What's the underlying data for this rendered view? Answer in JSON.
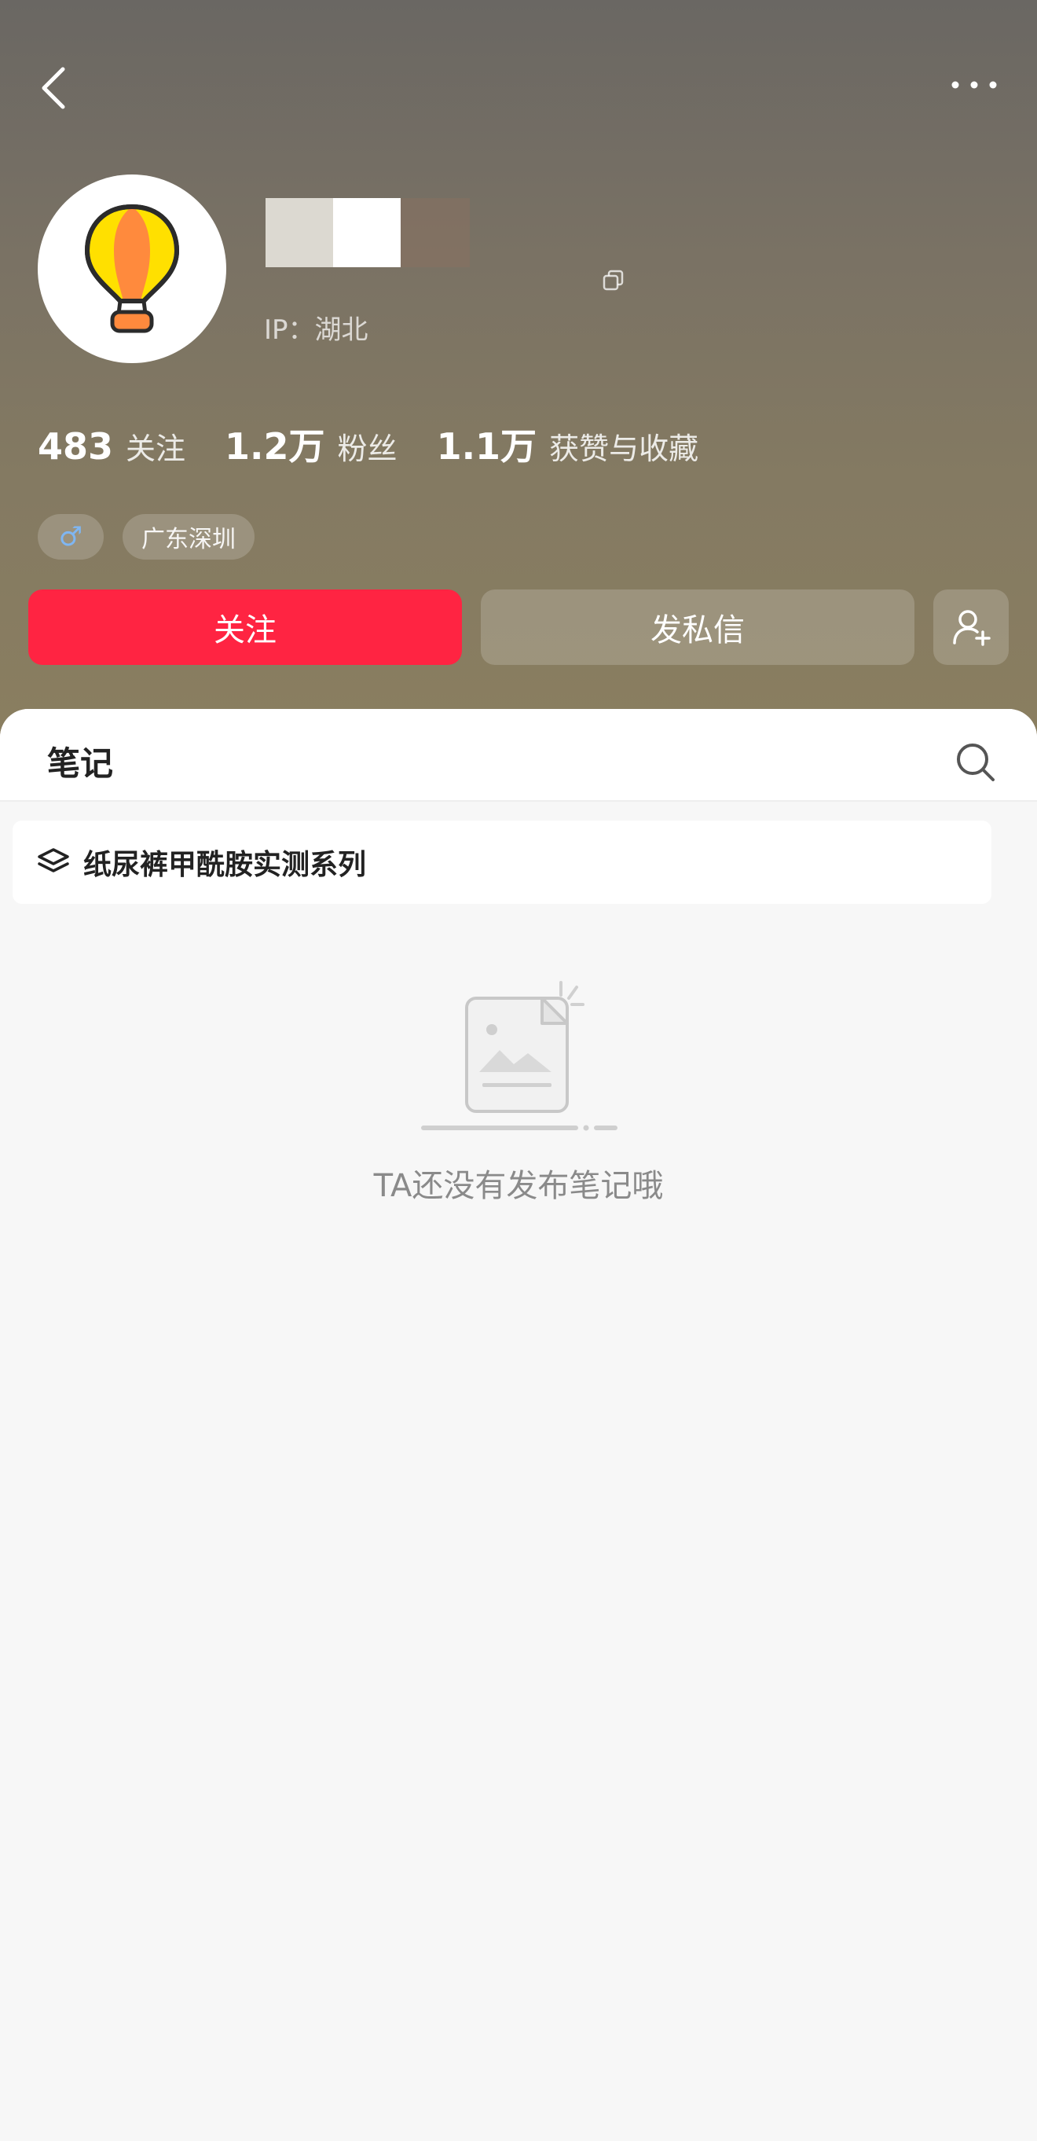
{
  "profile": {
    "ip_location": "IP：湖北",
    "stats": [
      {
        "value": "483",
        "label": "关注"
      },
      {
        "value": "1.2万",
        "label": "粉丝"
      },
      {
        "value": "1.1万",
        "label": "获赞与收藏"
      }
    ],
    "tags": {
      "gender_symbol": "♂",
      "location": "广东深圳"
    }
  },
  "actions": {
    "follow_label": "关注",
    "message_label": "发私信"
  },
  "notes": {
    "tab_title": "笔记",
    "collection_name": "纸尿裤甲酰胺实测系列",
    "empty_text": "TA还没有发布笔记哦"
  },
  "colors": {
    "accent": "#ff2442",
    "header_bg": "#7a7264"
  },
  "icons": [
    "back-icon",
    "more-icon",
    "balloon-avatar",
    "copy-icon",
    "male-icon",
    "add-friend-icon",
    "search-icon",
    "layers-icon",
    "empty-note-illustration"
  ]
}
